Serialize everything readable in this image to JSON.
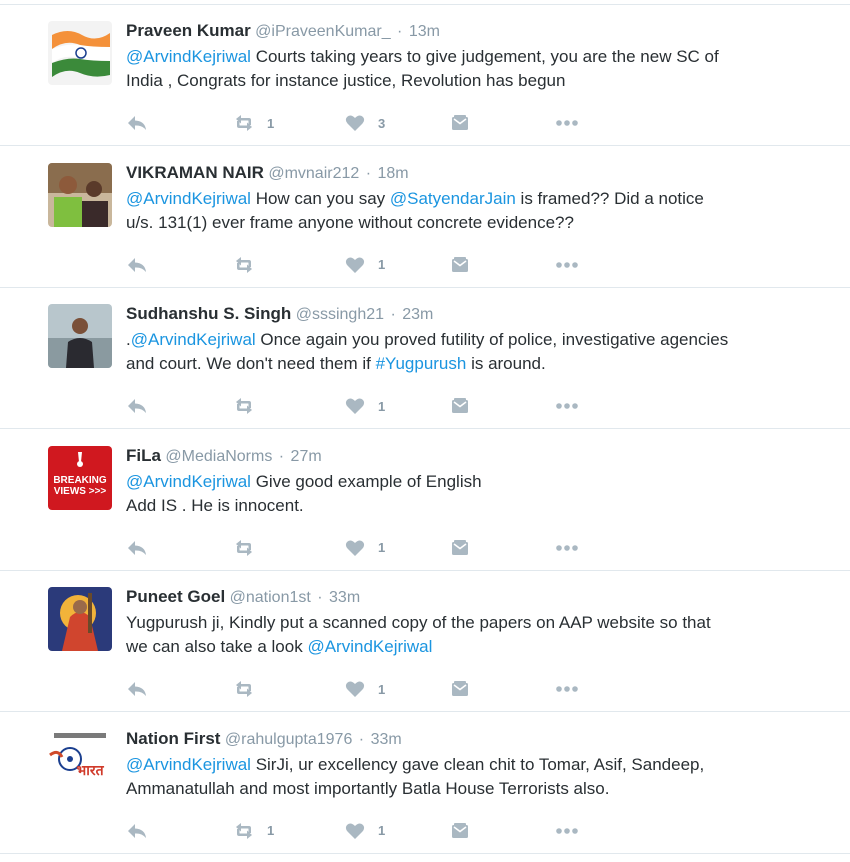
{
  "colors": {
    "link": "#1b95e0",
    "meta": "#8899a6",
    "icon": "#aab8c2",
    "border": "#e1e8ed"
  },
  "icons": {
    "reply": "reply-arrow",
    "retweet": "retweet-arrows",
    "like": "heart",
    "dm": "envelope",
    "more": "ellipsis"
  },
  "tweets": [
    {
      "name": "Praveen Kumar",
      "handle": "@iPraveenKumar_",
      "sep": "·",
      "time": "13m",
      "line1": [
        {
          "t": "@ArvindKejriwal",
          "link": true
        },
        {
          "t": "  Courts taking years to give judgement, you are the new SC of",
          "link": false
        }
      ],
      "line2": [
        {
          "t": "India , Congrats for instance justice, Revolution has begun",
          "link": false
        }
      ],
      "retweets": "1",
      "likes": "3"
    },
    {
      "name": "VIKRAMAN NAIR",
      "handle": "@mvnair212",
      "sep": "·",
      "time": "18m",
      "line1": [
        {
          "t": "@ArvindKejriwal",
          "link": true
        },
        {
          "t": " How can you say ",
          "link": false
        },
        {
          "t": "@SatyendarJain",
          "link": true
        },
        {
          "t": " is framed?? Did a notice",
          "link": false
        }
      ],
      "line2": [
        {
          "t": "u/s. 131(1) ever frame anyone without concrete evidence??",
          "link": false
        }
      ],
      "retweets": "",
      "likes": "1"
    },
    {
      "name": "Sudhanshu S. Singh",
      "handle": "@sssingh21",
      "sep": "·",
      "time": "23m",
      "line1": [
        {
          "t": ".",
          "link": false
        },
        {
          "t": "@ArvindKejriwal",
          "link": true
        },
        {
          "t": " Once again you proved futility of police, investigative agencies",
          "link": false
        }
      ],
      "line2": [
        {
          "t": "and court. We don't need them if ",
          "link": false
        },
        {
          "t": "#Yugpurush",
          "link": true
        },
        {
          "t": " is around.",
          "link": false
        }
      ],
      "retweets": "",
      "likes": "1"
    },
    {
      "name": "FiLa",
      "handle": "@MediaNorms",
      "sep": "·",
      "time": "27m",
      "avatar_text": [
        "BREAKING",
        "VIEWS >>>"
      ],
      "line1": [
        {
          "t": "@ArvindKejriwal",
          "link": true
        },
        {
          "t": " Give good example of English",
          "link": false
        }
      ],
      "line2": [
        {
          "t": "Add IS . He is innocent.",
          "link": false
        }
      ],
      "retweets": "",
      "likes": "1"
    },
    {
      "name": "Puneet Goel",
      "handle": "@nation1st",
      "sep": "·",
      "time": "33m",
      "line1": [
        {
          "t": "Yugpurush ji, Kindly put a scanned copy of the papers on AAP website so that",
          "link": false
        }
      ],
      "line2": [
        {
          "t": "we can also take a look ",
          "link": false
        },
        {
          "t": "@ArvindKejriwal",
          "link": true
        }
      ],
      "retweets": "",
      "likes": "1"
    },
    {
      "name": "Nation First",
      "handle": "@rahulgupta1976",
      "sep": "·",
      "time": "33m",
      "avatar_text": [
        "भारत"
      ],
      "line1": [
        {
          "t": "@ArvindKejriwal",
          "link": true
        },
        {
          "t": " SirJi, ur excellency gave clean chit to Tomar, Asif, Sandeep,",
          "link": false
        }
      ],
      "line2": [
        {
          "t": "Ammanatullah and most importantly Batla House Terrorists also.",
          "link": false
        }
      ],
      "retweets": "1",
      "likes": "1"
    }
  ]
}
